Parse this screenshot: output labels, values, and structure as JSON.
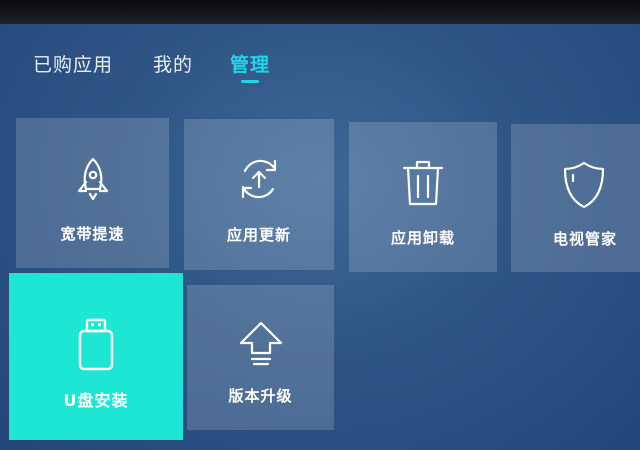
{
  "tabs": [
    {
      "label": "已购应用",
      "active": false
    },
    {
      "label": "我的",
      "active": false
    },
    {
      "label": "管理",
      "active": true
    }
  ],
  "tiles": [
    {
      "label": "宽带提速",
      "icon": "rocket-icon"
    },
    {
      "label": "应用更新",
      "icon": "refresh-icon"
    },
    {
      "label": "应用卸载",
      "icon": "trash-icon"
    },
    {
      "label": "电视管家",
      "icon": "shield-icon"
    },
    {
      "label": "U盘安装",
      "icon": "usb-drive-icon",
      "focused": true
    },
    {
      "label": "版本升级",
      "icon": "upgrade-arrow-icon"
    }
  ],
  "colors": {
    "accent": "#1fd5ea",
    "focus_tile": "#1de7d4",
    "background": "#2f5585"
  }
}
